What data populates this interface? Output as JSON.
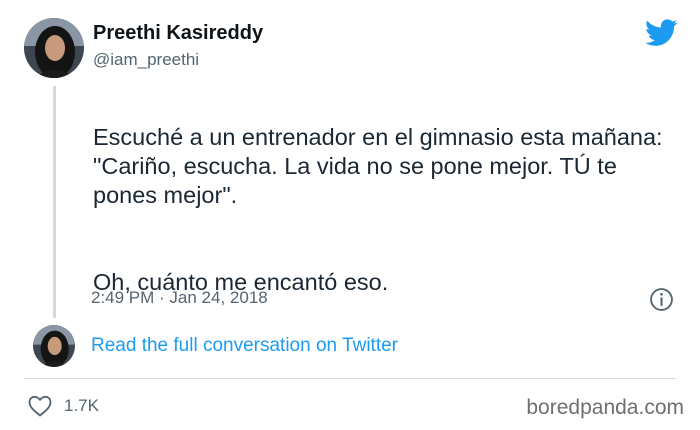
{
  "tweet": {
    "author_name": "Preethi Kasireddy",
    "author_handle": "@iam_preethi",
    "text_paragraph_1": "Escuché a un entrenador en el gimnasio esta mañana:\n\"Cariño, escucha. La vida no se pone mejor. TÚ te pones mejor\".",
    "text_paragraph_2": "Oh, cuánto me encantó eso.",
    "timestamp": "2:49 PM · Jan 24, 2018"
  },
  "conversation": {
    "link_label": "Read the full conversation on Twitter"
  },
  "engagement": {
    "like_count": "1.7K"
  },
  "watermark": "boredpanda.com",
  "icons": {
    "brand": "twitter-bird-icon",
    "info": "info-icon",
    "like": "heart-icon"
  },
  "colors": {
    "twitter_blue": "#1d9bf0",
    "text_primary": "#0f1419",
    "text_secondary": "#536471",
    "border": "#cfd9de"
  }
}
